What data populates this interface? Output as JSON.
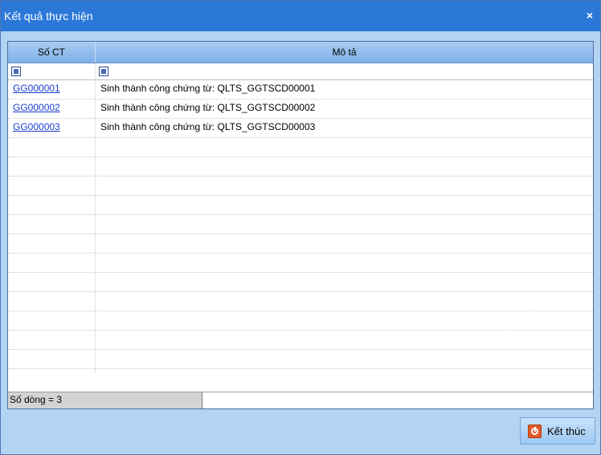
{
  "window": {
    "title": "Kết quả thực hiện",
    "close_glyph": "×"
  },
  "grid": {
    "columns": [
      "Số CT",
      "Mô tả"
    ],
    "rows": [
      {
        "so_ct": "GG000001",
        "mo_ta": "Sinh thành công chứng từ: QLTS_GGTSCD00001"
      },
      {
        "so_ct": "GG000002",
        "mo_ta": "Sinh thành công chứng từ: QLTS_GGTSCD00002"
      },
      {
        "so_ct": "GG000003",
        "mo_ta": "Sinh thành công chứng từ: QLTS_GGTSCD00003"
      }
    ],
    "status": "Số dòng = 3"
  },
  "footer": {
    "finish_label": "Kết thúc",
    "finish_icon": "power-icon"
  },
  "colors": {
    "titlebar": "#2b78d8",
    "window_bg": "#b3d3f3",
    "link": "#1a3ccc",
    "finish_icon": "#e0592a"
  }
}
